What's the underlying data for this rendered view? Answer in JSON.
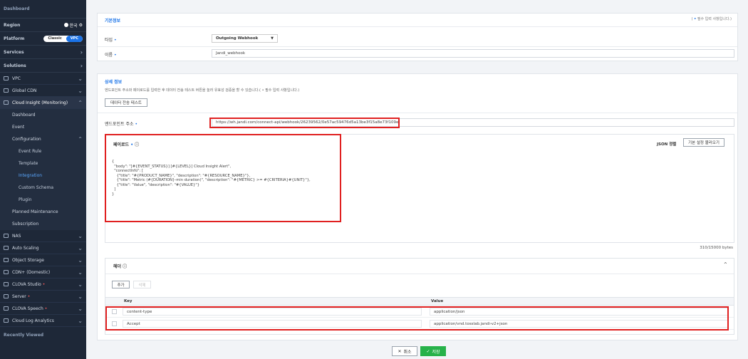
{
  "sidebar": {
    "dashboard": "Dashboard",
    "region_label": "Region",
    "region_value": "한국",
    "platform_label": "Platform",
    "platform_options": [
      "Classic",
      "VPC"
    ],
    "services": "Services",
    "solutions": "Solutions",
    "items_top": [
      "VPC",
      "Global CDN",
      "Cloud Insight (Monitoring)"
    ],
    "sub_items": [
      "Dashboard",
      "Event",
      "Configuration"
    ],
    "config_items": [
      "Event Rule",
      "Template",
      "Integration",
      "Custom Schema",
      "Plugin"
    ],
    "sub_items_after": [
      "Planned Maintenance",
      "Subscription"
    ],
    "items_bottom": [
      "NAS",
      "Auto Scaling",
      "Object Storage",
      "CDN+ (Domestic)",
      "CLOVA Studio",
      "Server",
      "CLOVA Speech",
      "Cloud Log Analytics"
    ],
    "recently_viewed": "Recently Viewed"
  },
  "basic": {
    "title": "기본정보",
    "req_note_prefix": "( ",
    "req_note_star": "•",
    "req_note_text": " 필수 입력 사항입니다.)",
    "type_label": "타입",
    "type_value": "Outgoing Webhook",
    "name_label": "이름",
    "name_value": "Jandi_webhook"
  },
  "detail": {
    "title": "상세 정보",
    "desc": "엔드포인트 주소와 페이로드를 입력한 후 데이터 전송 테스트 버튼을 눌러 유효성 검증을 할 수 있습니다.( • 필수 입력 사항입니다.)",
    "test_button": "데이터 전송 테스트",
    "endpoint_label": "엔드포인트 주소",
    "endpoint_value": "https://wh.jandi.com/connect-api/webhook/26239562/0e57ac59476d5a13be3f15a8e73f109e",
    "payload_label": "페이로드",
    "json_sort": "JSON 정렬",
    "load_default": "기본 설정 불러오기",
    "payload_text": "{\n  \"body\": \"[#{EVENT_STATUS}] [#{LEVEL}] Cloud Insight Alert\",\n  \"connectInfo\": [\n    {\"title\": \"#{PRODUCT_NAME}\", \"description\": \"#{RESOURCE_NAME}\"},\n    {\"title\": \"Metric (#{DURATION}-min duration)\", \"description\": \"#{METRIC} >= #{CRITERIA}#{UNIT}\"},\n    {\"title\": \"Value\", \"description\": \"#{VALUE}\"}\n  ]\n}",
    "bytes": "310/15000 bytes"
  },
  "header": {
    "title": "헤더",
    "add": "추가",
    "delete": "삭제",
    "col_key": "Key",
    "col_value": "Value",
    "rows": [
      {
        "key": "content-type",
        "value": "application/json"
      },
      {
        "key": "Accept",
        "value": "application/vnd.tosslab.jandi-v2+json"
      }
    ]
  },
  "footer": {
    "cancel": "취소",
    "save": "저장"
  },
  "colors": {
    "sidebar_bg": "#1e2838",
    "accent": "#1a73e8",
    "highlight_red": "#e02020",
    "save_green": "#27b24a"
  }
}
